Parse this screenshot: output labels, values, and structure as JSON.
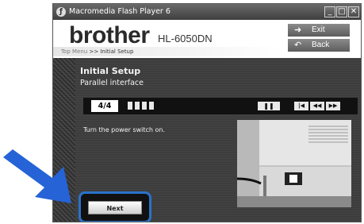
{
  "window": {
    "title": "Macromedia Flash Player 6",
    "controls": {
      "minimize": "_",
      "maximize": "□",
      "close": "✕"
    }
  },
  "header": {
    "brand": "brother",
    "model": "HL-6050DN",
    "breadcrumb": {
      "first": "Top Menu",
      "separator": ">>",
      "current": "Initial Setup"
    },
    "buttons": {
      "exit": "Exit",
      "back": "Back"
    }
  },
  "main": {
    "title": "Initial Setup",
    "subtitle": "Parallel interface",
    "step": "4/4",
    "instruction": "Turn the power switch on.",
    "next_label": "Next"
  },
  "colors": {
    "highlight": "#2a73c9",
    "arrow": "#2563d6",
    "window_bg": "#3d3d3d"
  }
}
